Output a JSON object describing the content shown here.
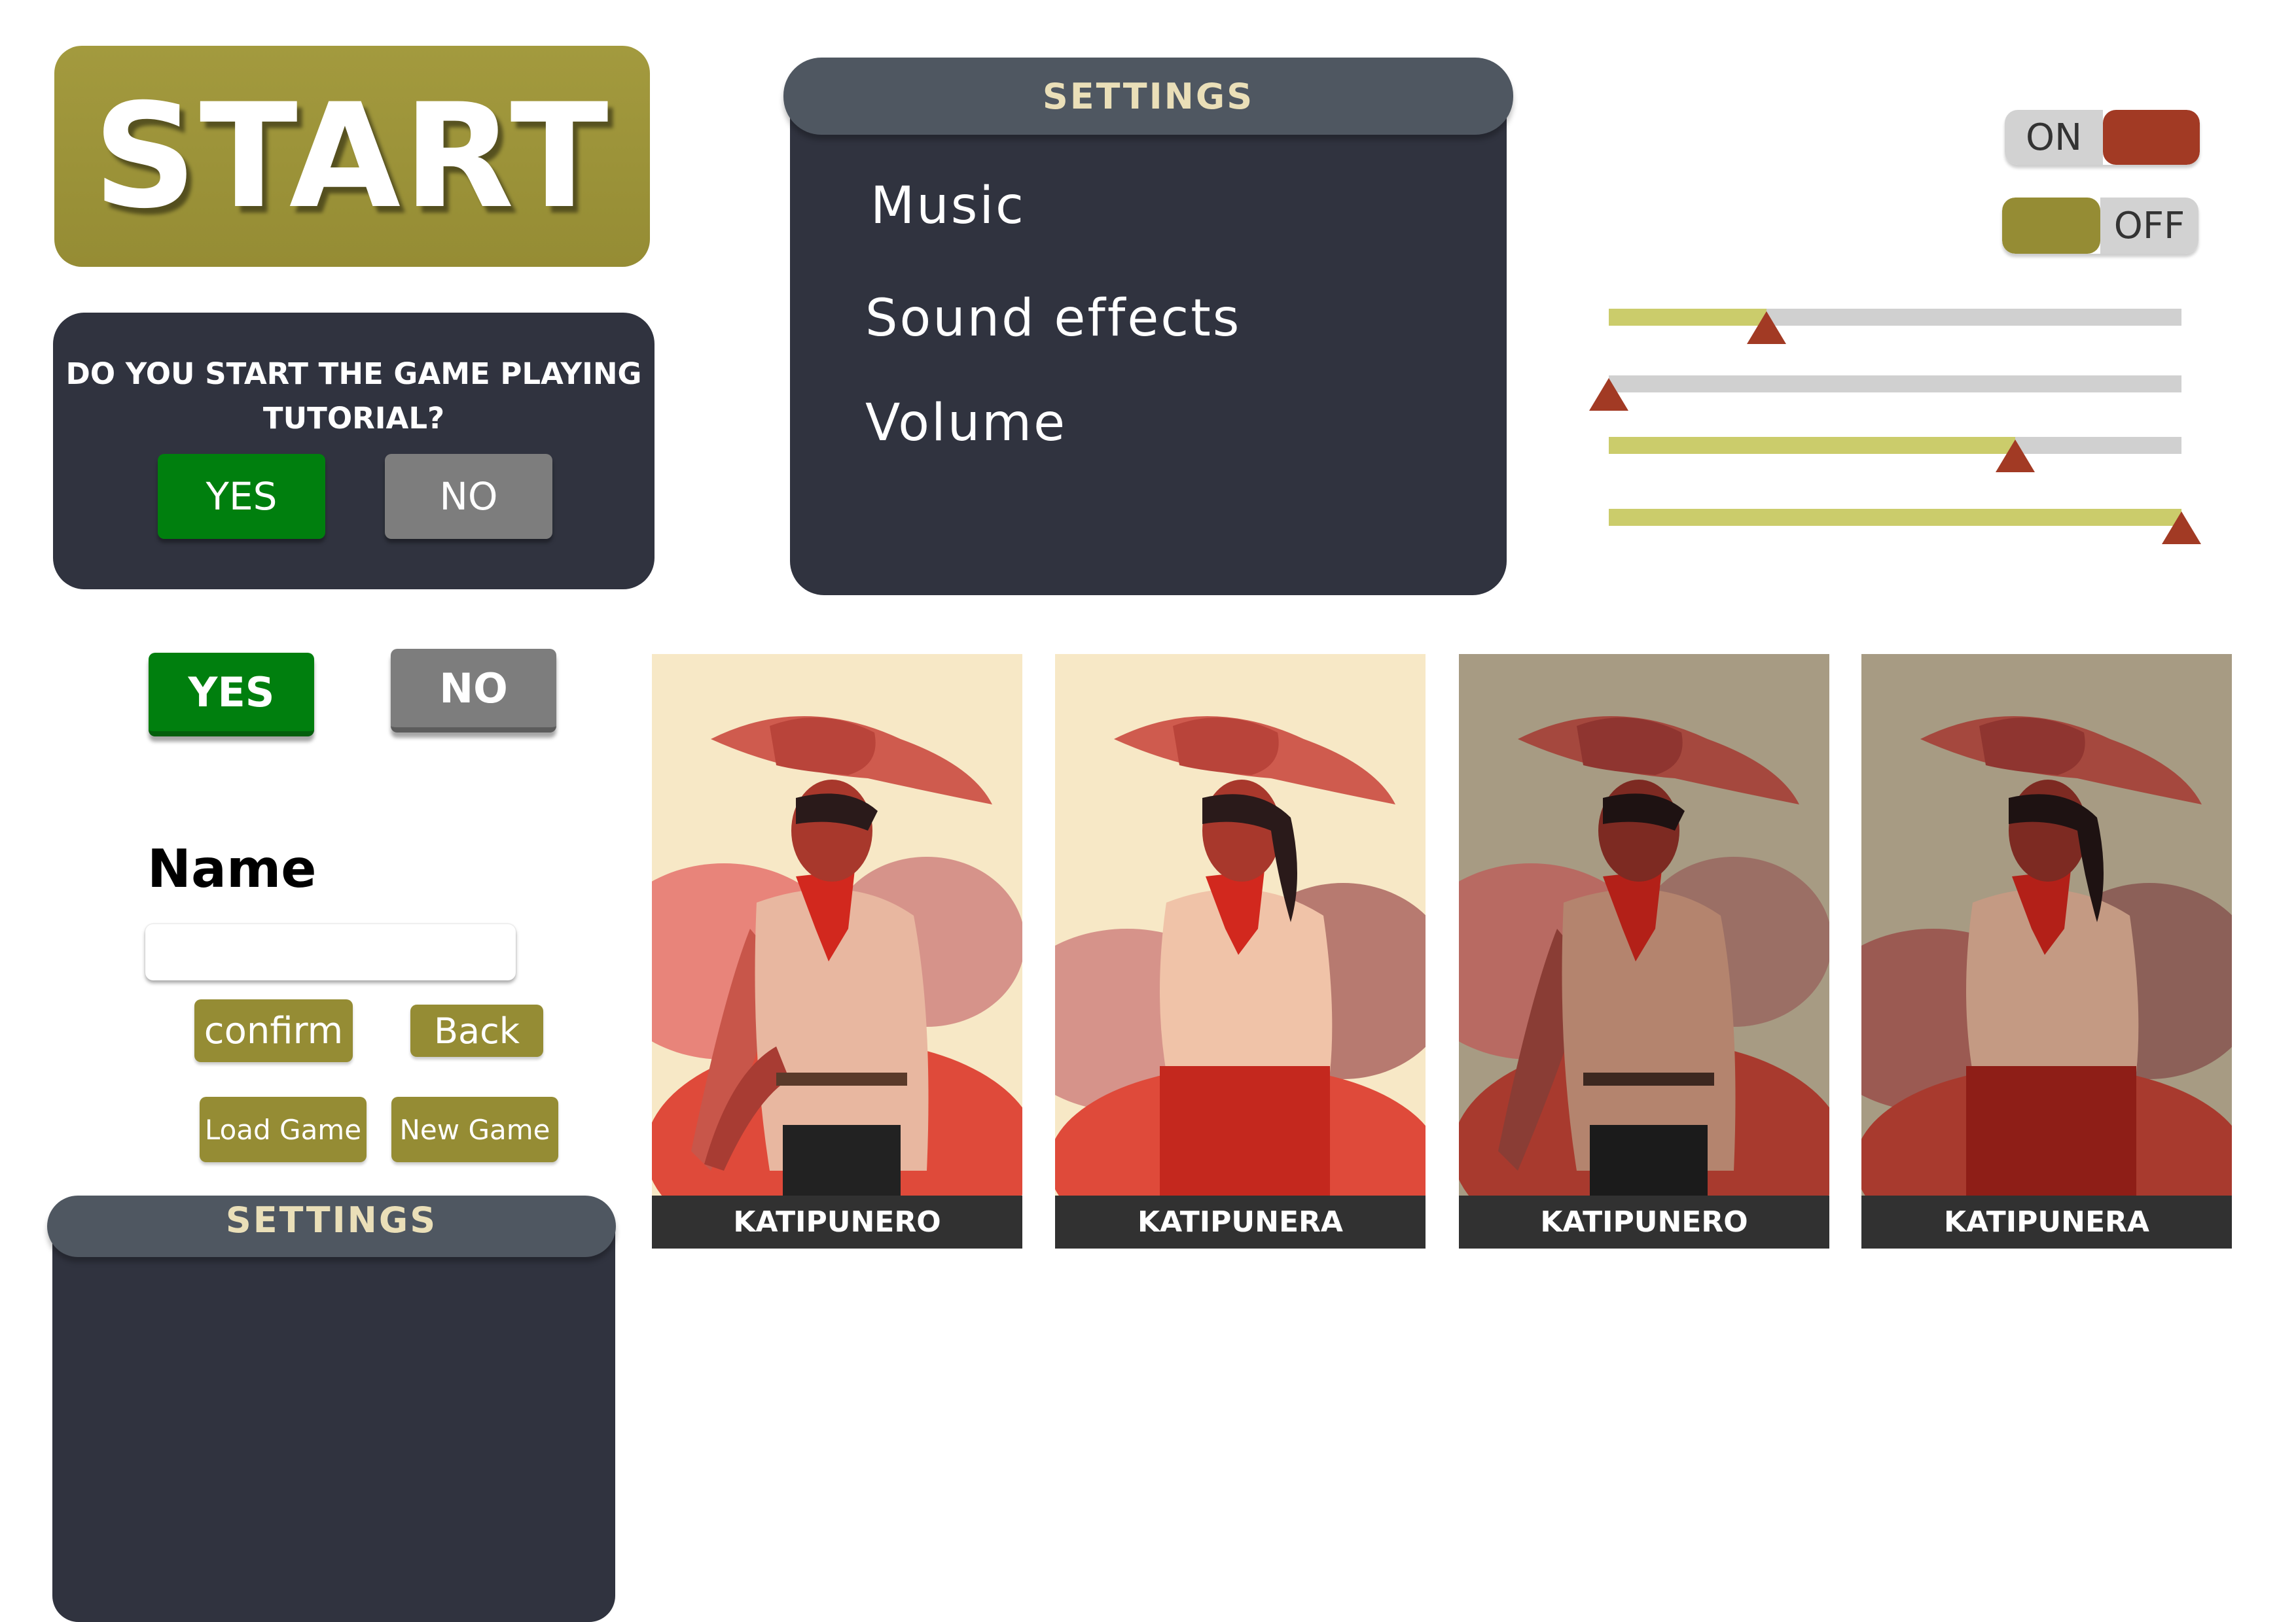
{
  "start_button": {
    "label": "START"
  },
  "tutorial_dialog": {
    "question": "DO YOU START THE GAME PLAYING TUTORIAL?",
    "yes_label": "YES",
    "no_label": "NO"
  },
  "settings_panel": {
    "title": "SETTINGS",
    "items": [
      {
        "label": "Music"
      },
      {
        "label": "Sound effects"
      },
      {
        "label": "Volume"
      }
    ]
  },
  "toggles": {
    "on": {
      "label": "ON",
      "fill_color": "#a23a24"
    },
    "off": {
      "label": "OFF",
      "fill_color": "#958c34"
    }
  },
  "sliders": [
    {
      "value": 0.275
    },
    {
      "value": 0.0
    },
    {
      "value": 0.71
    },
    {
      "value": 1.0
    }
  ],
  "buttons_alt": {
    "yes_label": "YES",
    "no_label": "NO"
  },
  "name_form": {
    "label": "Name",
    "input_value": "",
    "input_placeholder": "",
    "confirm_label": "confirm",
    "back_label": "Back"
  },
  "game_menu": {
    "load_label": "Load Game",
    "new_label": "New Game"
  },
  "settings_panel_small": {
    "title": "SETTINGS"
  },
  "characters": [
    {
      "name": "KATIPUNERO",
      "variant": "male",
      "tone": "light"
    },
    {
      "name": "KATIPUNERA",
      "variant": "female",
      "tone": "light"
    },
    {
      "name": "KATIPUNERO",
      "variant": "male",
      "tone": "muted"
    },
    {
      "name": "KATIPUNERA",
      "variant": "female",
      "tone": "muted"
    }
  ],
  "colors": {
    "olive": "#958c34",
    "panel_dark": "#30333f",
    "panel_header": "#4f5761",
    "header_text": "#eadfb8",
    "yes_green": "#007f0e",
    "no_gray": "#7d7d7d",
    "accent_red": "#a23a24",
    "slider_fill": "#cbcc6b",
    "slider_track": "#d0d0d0"
  }
}
